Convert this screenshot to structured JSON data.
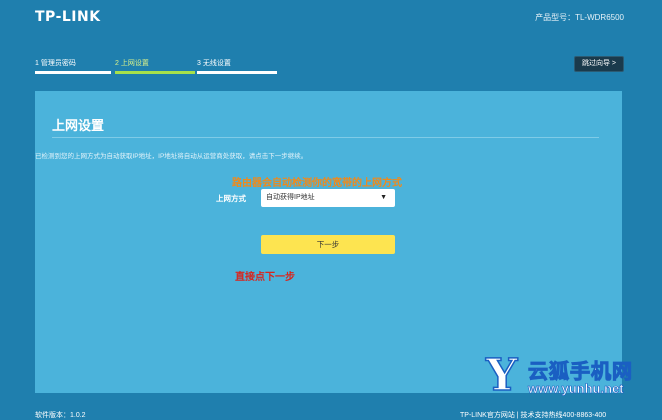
{
  "header": {
    "logo": "TP-LINK",
    "model_label": "产品型号：TL-WDR6500"
  },
  "steps": [
    {
      "label": "1 管理员密码",
      "active": false
    },
    {
      "label": "2 上网设置",
      "active": true
    },
    {
      "label": "3 无线设置",
      "active": false
    }
  ],
  "skip_button": "跳过向导 >",
  "panel": {
    "title": "上网设置",
    "description": "已检测到您的上网方式为自动获取IP地址，IP地址将自动从运营商处获取，请点击下一步继续。",
    "annotation_orange": "路由器会自动检测你的宽带的上网方式",
    "field_label": "上网方式",
    "select_value": "自动获得IP地址",
    "next_button": "下一步",
    "annotation_red": "直接点下一步"
  },
  "watermark": {
    "letter": "Y",
    "name": "云狐手机网",
    "url": "www.yunhu.net"
  },
  "footer": {
    "left": "软件版本：1.0.2",
    "right": "TP-LINK官方网站 | 技术支持热线400-8863-400"
  },
  "colors": {
    "background": "#1f7fae",
    "panel": "#4bb3db",
    "active_step": "#a6e14b",
    "next_button": "#fde450",
    "annotation_orange": "#f08a1a",
    "annotation_red": "#d9241c"
  }
}
